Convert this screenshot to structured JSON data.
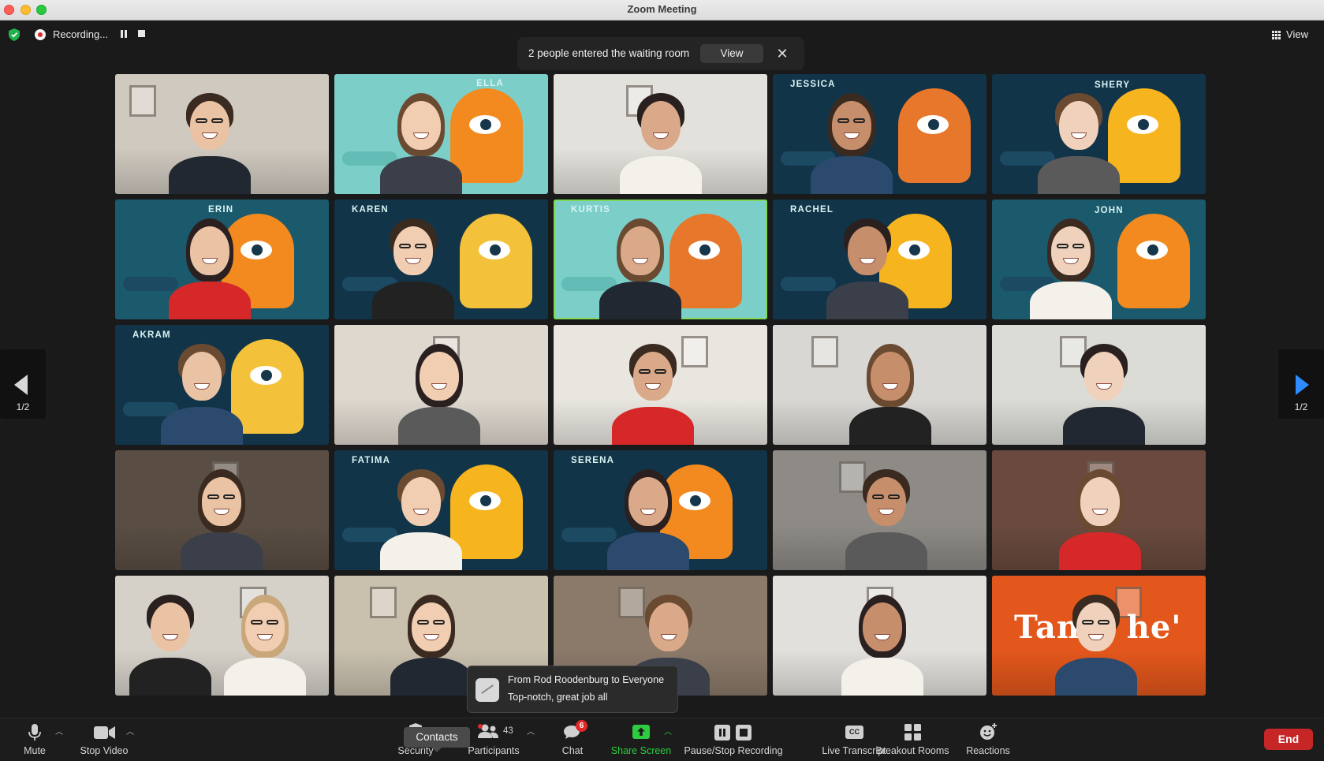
{
  "window": {
    "title": "Zoom Meeting"
  },
  "recording": {
    "status": "Recording..."
  },
  "view_toggle": {
    "label": "View"
  },
  "waiting_notice": {
    "message": "2 people entered the waiting room",
    "view_label": "View",
    "close_glyph": "✕"
  },
  "nav": {
    "page": "1/2"
  },
  "tiles": [
    {
      "name": "",
      "bg": "#cfc9bf"
    },
    {
      "name": "ELLA",
      "bg": "#7ccfc9"
    },
    {
      "name": "",
      "bg": "#e3e1db"
    },
    {
      "name": "JESSICA",
      "bg": "#123449"
    },
    {
      "name": "SHERY",
      "bg": "#123449"
    },
    {
      "name": "ERIN",
      "bg": "#1a5a6c"
    },
    {
      "name": "KAREN",
      "bg": "#123449"
    },
    {
      "name": "KURTIS",
      "bg": "#7ccfc9"
    },
    {
      "name": "RACHEL",
      "bg": "#123449"
    },
    {
      "name": "JOHN",
      "bg": "#1a5a6c"
    },
    {
      "name": "AKRAM",
      "bg": "#123449"
    },
    {
      "name": "",
      "bg": "#dfd8cf"
    },
    {
      "name": "",
      "bg": "#e9e6e0"
    },
    {
      "name": "",
      "bg": "#d9d7d3"
    },
    {
      "name": "",
      "bg": "#dcdcd7"
    },
    {
      "name": "",
      "bg": "#5a4e44"
    },
    {
      "name": "FATIMA",
      "bg": "#123449"
    },
    {
      "name": "SERENA",
      "bg": "#123449"
    },
    {
      "name": "",
      "bg": "#8e8b86"
    },
    {
      "name": "",
      "bg": "#6a4a3e"
    },
    {
      "name": "",
      "bg": "#d5d1c9"
    },
    {
      "name": "",
      "bg": "#c9c0ae"
    },
    {
      "name": "",
      "bg": "#8b7a6a"
    },
    {
      "name": "",
      "bg": "#e2e0dc"
    },
    {
      "name": "",
      "bg": "#e3571c"
    }
  ],
  "logo_text": "Tang  he'",
  "chat_toast": {
    "from": "From Rod Roodenburg to Everyone",
    "message": "Top-notch, great job all"
  },
  "toolbar": {
    "mute": "Mute",
    "stop_video": "Stop Video",
    "security": "Security",
    "contacts_tooltip": "Contacts",
    "participants": "Participants",
    "participants_count": "43",
    "chat": "Chat",
    "chat_badge": "6",
    "share_screen": "Share Screen",
    "pause_stop_recording": "Pause/Stop Recording",
    "live_transcript": "Live Transcript",
    "live_transcript_glyph": "CC",
    "breakout_rooms": "Breakout Rooms",
    "reactions": "Reactions",
    "end": "End"
  },
  "colors": {
    "end": "#c72626",
    "share": "#2ecc40",
    "active_speaker": "#7ed957",
    "nav_arrow": "#2d8cff"
  }
}
